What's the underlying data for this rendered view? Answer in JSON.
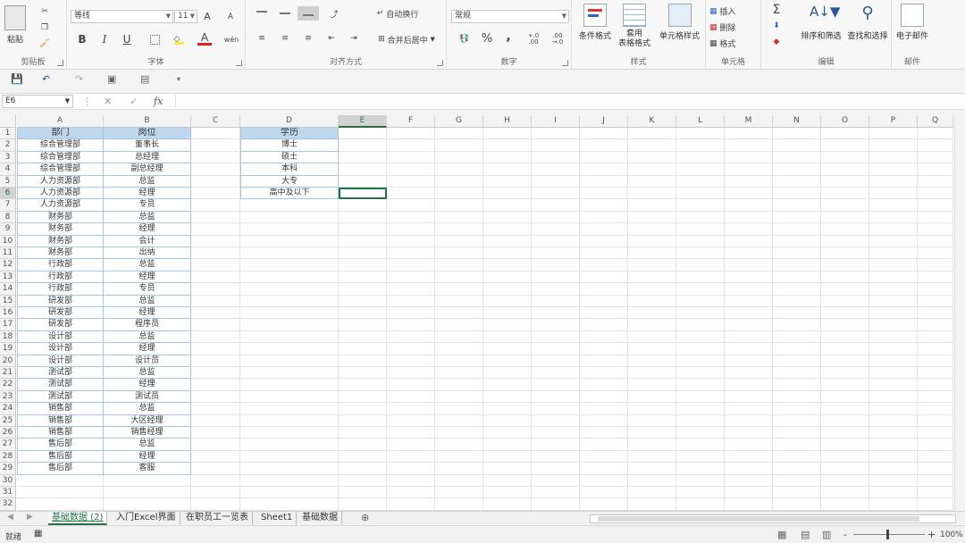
{
  "ribbon": {
    "clipboard": {
      "paste_label": "粘贴",
      "group_label": "剪贴板"
    },
    "font": {
      "font_name": "等线",
      "font_size": "11",
      "bold": "B",
      "italic": "I",
      "underline": "U",
      "grow": "A",
      "shrink": "A",
      "font_color_letter": "A",
      "phonetic": "wén",
      "group_label": "字体"
    },
    "alignment": {
      "wrap_text": "自动换行",
      "merge_center": "合并后居中",
      "group_label": "对齐方式"
    },
    "number": {
      "format": "常规",
      "percent": "%",
      "comma": ",",
      "inc_decimal": "+.0 .00",
      "dec_decimal": ".00 →.0",
      "group_label": "数字"
    },
    "styles": {
      "conditional": "条件格式",
      "table_format_1": "套用",
      "table_format_2": "表格格式",
      "cell_styles": "单元格样式",
      "group_label": "样式"
    },
    "cells": {
      "insert": "插入",
      "delete": "删除",
      "format": "格式",
      "group_label": "单元格"
    },
    "editing": {
      "sum": "Σ",
      "sort_filter": "排序和筛选",
      "find_select": "查找和选择",
      "group_label": "编辑"
    },
    "mail": {
      "email": "电子邮件",
      "group_label": "邮件"
    }
  },
  "formula_bar": {
    "name_box": "E6",
    "cancel": "✕",
    "enter": "✓",
    "fx": "fx",
    "value": ""
  },
  "sheet": {
    "columns": [
      "A",
      "B",
      "C",
      "D",
      "E",
      "F",
      "G",
      "H",
      "I",
      "J",
      "K",
      "L",
      "M",
      "N",
      "O",
      "P",
      "Q"
    ],
    "rows": [
      "1",
      "2",
      "3",
      "4",
      "5",
      "6",
      "7",
      "8",
      "9",
      "10",
      "11",
      "12",
      "13",
      "14",
      "15",
      "16",
      "17",
      "18",
      "19",
      "20",
      "21",
      "22",
      "23",
      "24",
      "25",
      "26",
      "27",
      "28",
      "29",
      "30",
      "31",
      "32"
    ],
    "header_a": "部门",
    "header_b": "岗位",
    "header_d": "学历",
    "col_a": [
      "综合管理部",
      "综合管理部",
      "综合管理部",
      "人力资源部",
      "人力资源部",
      "人力资源部",
      "财务部",
      "财务部",
      "财务部",
      "财务部",
      "行政部",
      "行政部",
      "行政部",
      "研发部",
      "研发部",
      "研发部",
      "设计部",
      "设计部",
      "设计部",
      "测试部",
      "测试部",
      "测试部",
      "销售部",
      "销售部",
      "销售部",
      "售后部",
      "售后部",
      "售后部"
    ],
    "col_b": [
      "董事长",
      "总经理",
      "副总经理",
      "总监",
      "经理",
      "专员",
      "总监",
      "经理",
      "会计",
      "出纳",
      "总监",
      "经理",
      "专员",
      "总监",
      "经理",
      "程序员",
      "总监",
      "经理",
      "设计员",
      "总监",
      "经理",
      "测试员",
      "总监",
      "大区经理",
      "销售经理",
      "总监",
      "经理",
      "客服"
    ],
    "col_d": [
      "博士",
      "硕士",
      "本科",
      "大专",
      "高中及以下"
    ]
  },
  "tabs": [
    "基础数据 (2)",
    "入门Excel界面",
    "在职员工一览表",
    "Sheet1",
    "基础数据"
  ],
  "active_tab": 0,
  "status": {
    "ready": "就绪",
    "zoom": "100%",
    "zoom_minus": "-",
    "zoom_plus": "+"
  },
  "colors": {
    "accent": "#217346",
    "header_fill": "#bdd7ee",
    "qat_icon": "#2b579a"
  }
}
